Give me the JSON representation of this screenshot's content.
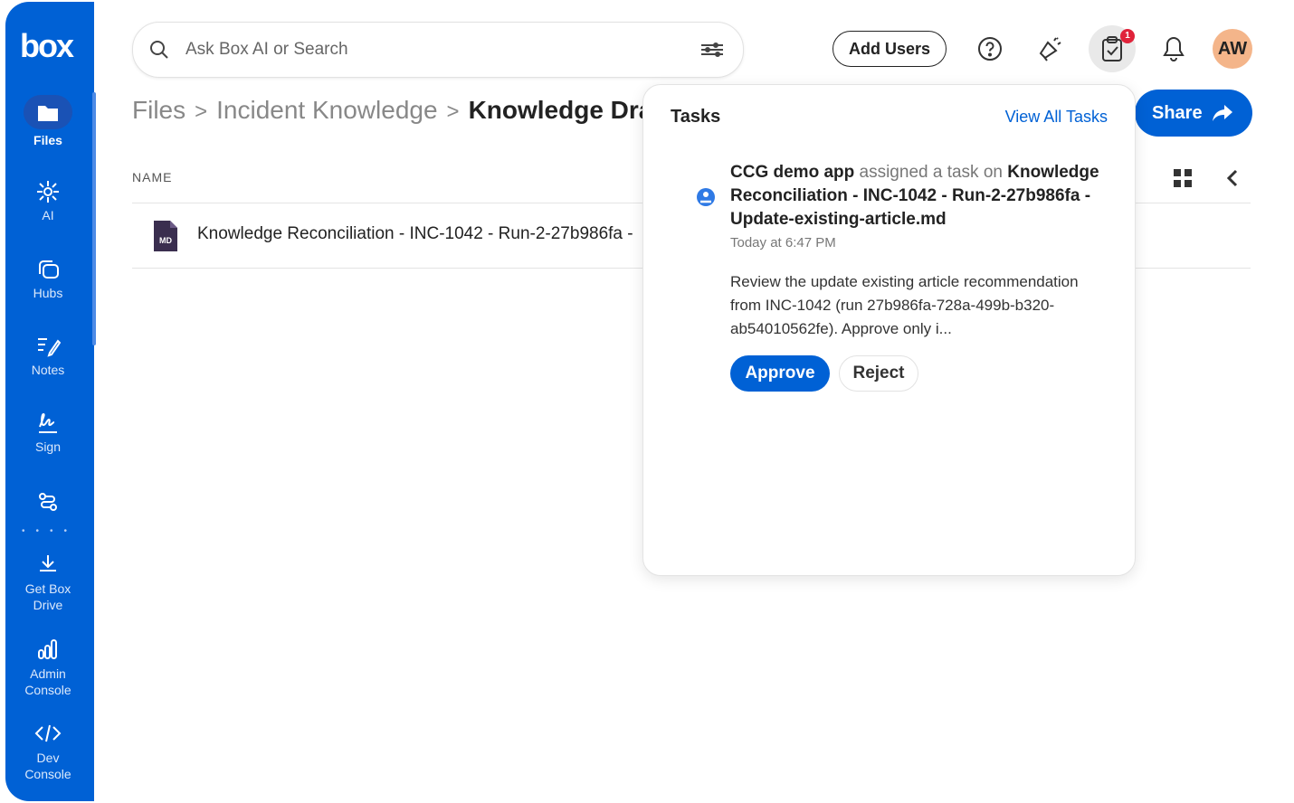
{
  "sidebar": {
    "logo": "box",
    "items": [
      {
        "label": "Files",
        "icon": "folder-icon"
      },
      {
        "label": "AI",
        "icon": "ai-icon"
      },
      {
        "label": "Hubs",
        "icon": "hubs-icon"
      },
      {
        "label": "Notes",
        "icon": "notes-icon"
      },
      {
        "label": "Sign",
        "icon": "sign-icon"
      },
      {
        "label": "",
        "icon": "automate-icon"
      },
      {
        "label": "Get Box Drive",
        "icon": "download-icon"
      },
      {
        "label": "Admin Console",
        "icon": "admin-icon"
      },
      {
        "label": "Dev Console",
        "icon": "code-icon"
      }
    ]
  },
  "search": {
    "placeholder": "Ask Box AI or Search"
  },
  "header": {
    "add_users": "Add Users",
    "task_badge": "1",
    "avatar_initials": "AW",
    "share": "Share"
  },
  "breadcrumb": {
    "items": [
      "Files",
      "Incident Knowledge"
    ],
    "current": "Knowledge Drafts"
  },
  "list": {
    "column_name": "NAME",
    "file": {
      "type": "MD",
      "name": "Knowledge Reconciliation - INC-1042 - Run-2-27b986fa -"
    }
  },
  "tasks_panel": {
    "title": "Tasks",
    "view_all": "View All Tasks",
    "task": {
      "actor": "CCG demo app",
      "verb": "assigned a task on",
      "target": "Knowledge Reconciliation - INC-1042 - Run-2-27b986fa - Update-existing-article.md",
      "time": "Today at 6:47 PM",
      "description": "Review the update existing article recommendation from INC-1042 (run 27b986fa-728a-499b-b320-ab54010562fe). Approve only i...",
      "approve": "Approve",
      "reject": "Reject"
    }
  },
  "colors": {
    "brand": "#0061d5",
    "avatar": "#f4b58a",
    "badge": "#e0233a"
  }
}
